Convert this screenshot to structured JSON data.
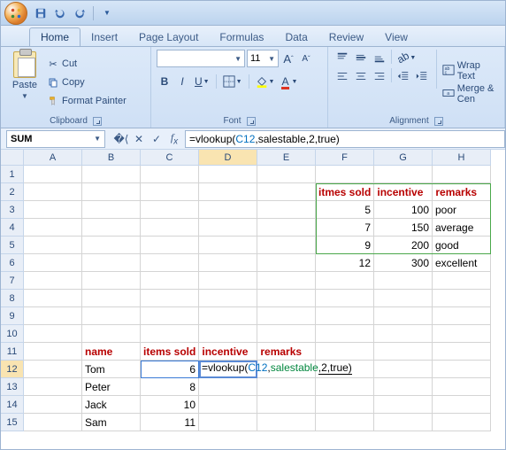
{
  "qat": {
    "save": "Save",
    "undo": "Undo",
    "redo": "Redo"
  },
  "tabs": [
    "Home",
    "Insert",
    "Page Layout",
    "Formulas",
    "Data",
    "Review",
    "View"
  ],
  "active_tab": 0,
  "ribbon": {
    "clipboard": {
      "label": "Clipboard",
      "paste": "Paste",
      "cut": "Cut",
      "copy": "Copy",
      "format_painter": "Format Painter"
    },
    "font": {
      "label": "Font",
      "name": "",
      "size": "11",
      "grow": "A",
      "shrink": "A",
      "bold": "B",
      "italic": "I",
      "underline": "U"
    },
    "alignment": {
      "label": "Alignment",
      "wrap": "Wrap Text",
      "merge": "Merge & Cen"
    }
  },
  "namebox": "SUM",
  "formula": {
    "raw": "=vlookup(C12,salestable,2,true)",
    "fn": "=vlookup(",
    "ref": "C12",
    "sep1": ",",
    "name": "salestable",
    "rest": ",2,true)"
  },
  "columns": [
    "A",
    "B",
    "C",
    "D",
    "E",
    "F",
    "G",
    "H"
  ],
  "rows": [
    1,
    2,
    3,
    4,
    5,
    6,
    7,
    8,
    9,
    10,
    11,
    12,
    13,
    14,
    15
  ],
  "active_cell": {
    "row": 12,
    "col": "D"
  },
  "lookup_table": {
    "header": {
      "items_sold": "itmes sold",
      "incentive": "incentive",
      "remarks": "remarks"
    },
    "rows": [
      {
        "items_sold": 5,
        "incentive": 100,
        "remarks": "poor"
      },
      {
        "items_sold": 7,
        "incentive": 150,
        "remarks": "average"
      },
      {
        "items_sold": 9,
        "incentive": 200,
        "remarks": "good"
      },
      {
        "items_sold": 12,
        "incentive": 300,
        "remarks": "excellent"
      }
    ]
  },
  "data_table": {
    "header": {
      "name": "name",
      "items_sold": "items sold",
      "incentive": "incentive",
      "remarks": "remarks"
    },
    "rows": [
      {
        "name": "Tom",
        "items_sold": 6
      },
      {
        "name": "Peter",
        "items_sold": 8
      },
      {
        "name": "Jack",
        "items_sold": 10
      },
      {
        "name": "Sam",
        "items_sold": 11
      }
    ]
  },
  "cell_formula_display": {
    "fn": "=vlookup(",
    "ref": "C12",
    "sep1": ",",
    "name": "salestable",
    "rest": ",2,true)"
  }
}
